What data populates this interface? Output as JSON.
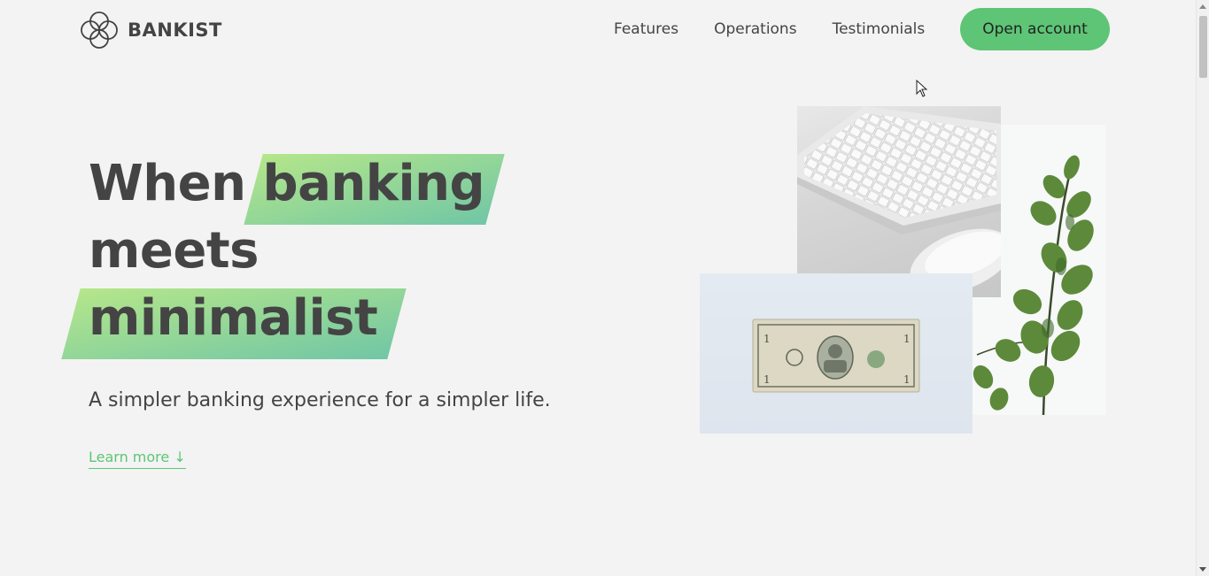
{
  "brand": {
    "name": "BANKIST",
    "logo_icon": "four-circles-logo"
  },
  "nav": {
    "links": [
      "Features",
      "Operations",
      "Testimonials"
    ],
    "cta": "Open account"
  },
  "hero": {
    "title_word_1": "When",
    "title_highlight_1": "banking",
    "title_word_2": "meets",
    "title_highlight_2": "minimalist",
    "subtitle": "A simpler banking experience for a simpler life.",
    "learn_more": "Learn more ↓"
  },
  "colors": {
    "background": "#f3f3f3",
    "accent": "#5ec576",
    "highlight_start": "#9be15d",
    "highlight_end": "#39b385",
    "text": "#444444"
  },
  "images": [
    "keyboard-mouse-photo",
    "dollar-bill-photo",
    "eucalyptus-plant-photo"
  ]
}
